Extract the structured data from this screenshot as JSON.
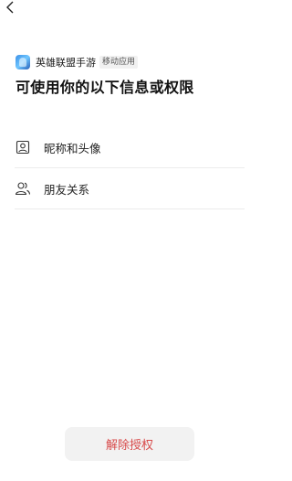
{
  "nav": {
    "back_icon": "chevron-left-icon"
  },
  "app": {
    "name": "英雄联盟手游",
    "tag": "移动应用",
    "logo_icon": "app-logo-icon"
  },
  "title": "可使用你的以下信息或权限",
  "permissions": [
    {
      "label": "昵称和头像",
      "icon": "profile-card-icon"
    },
    {
      "label": "朋友关系",
      "icon": "friends-icon"
    }
  ],
  "actions": {
    "revoke_label": "解除授权"
  },
  "colors": {
    "revoke_text": "#d84a4a",
    "button_bg": "#f2f2f2",
    "divider": "#ececec"
  }
}
